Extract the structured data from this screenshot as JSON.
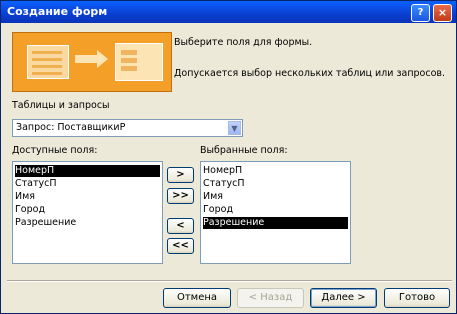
{
  "window": {
    "title": "Создание форм",
    "help_label": "?",
    "close_label": "×"
  },
  "intro": {
    "line1": "Выберите поля для формы.",
    "line2": "Допускается выбор нескольких таблиц или запросов."
  },
  "source": {
    "label": "Таблицы и запросы",
    "selected": "Запрос: ПоставщикиР"
  },
  "available": {
    "label": "Доступные поля:",
    "items": [
      "НомерП",
      "СтатусП",
      "Имя",
      "Город",
      "Разрешение"
    ],
    "selected_index": 0
  },
  "selected_fields": {
    "label": "Выбранные поля:",
    "items": [
      "НомерП",
      "СтатусП",
      "Имя",
      "Город",
      "Разрешение"
    ],
    "selected_index": 4
  },
  "move_buttons": {
    "add": ">",
    "add_all": ">>",
    "remove": "<",
    "remove_all": "<<"
  },
  "footer": {
    "cancel": "Отмена",
    "back": "< Назад",
    "next": "Далее >",
    "finish": "Готово"
  }
}
